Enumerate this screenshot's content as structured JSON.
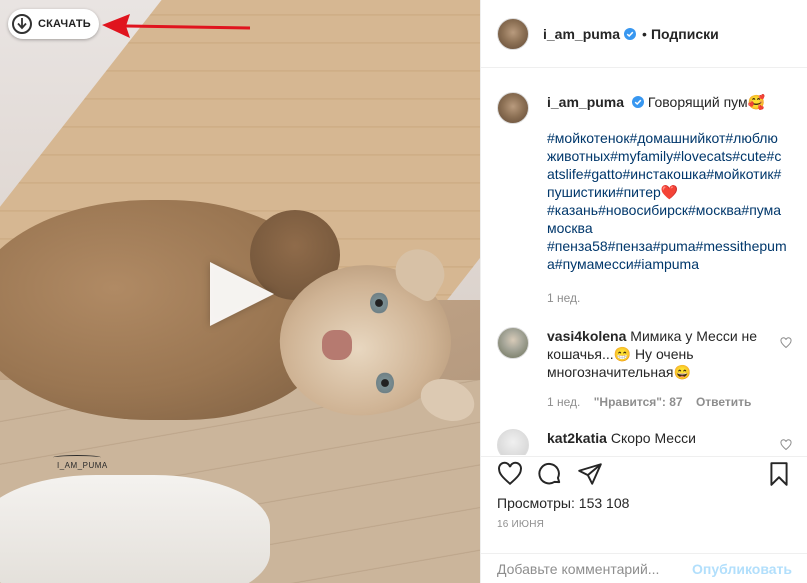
{
  "media": {
    "download_label": "СКАЧАТЬ",
    "watermark": "I_AM_PUMA",
    "play_icon": "play-icon"
  },
  "header": {
    "username": "i_am_puma",
    "separator": "•",
    "follow_label": "Подписки"
  },
  "caption": {
    "username": "i_am_puma",
    "text": "Говорящий пум🥰",
    "hashtags_1": "#мойкотенок#домашнийкот#люблюживотных#myfamily#lovecats#cute#catslife#gatto#инстакошка#мойкотик#пушистики#питер",
    "heart": "❤️",
    "hashtags_2": "#казань#новосибирск#москва#пумамосква",
    "hashtags_3": "#пенза58#пенза#puma#messithepuma#пумамесси#iampuma",
    "time": "1 нед."
  },
  "comments": [
    {
      "username": "vasi4kolena",
      "text": "Мимика у Месси не кошачья...😁 Ну очень многозначительная😄",
      "time": "1 нед.",
      "likes": "\"Нравится\": 87",
      "reply": "Ответить"
    },
    {
      "username": "kat2katia",
      "text": "Скоро Месси"
    }
  ],
  "actions": {
    "views_label": "Просмотры:",
    "views_count": "153 108",
    "date": "16 июня"
  },
  "add_comment": {
    "placeholder": "Добавьте комментарий...",
    "publish_label": "Опубликовать"
  },
  "colors": {
    "hashtag": "#00376b",
    "verified": "#3897f0",
    "publish_disabled": "#b2dffc",
    "arrow": "#e0141e"
  }
}
